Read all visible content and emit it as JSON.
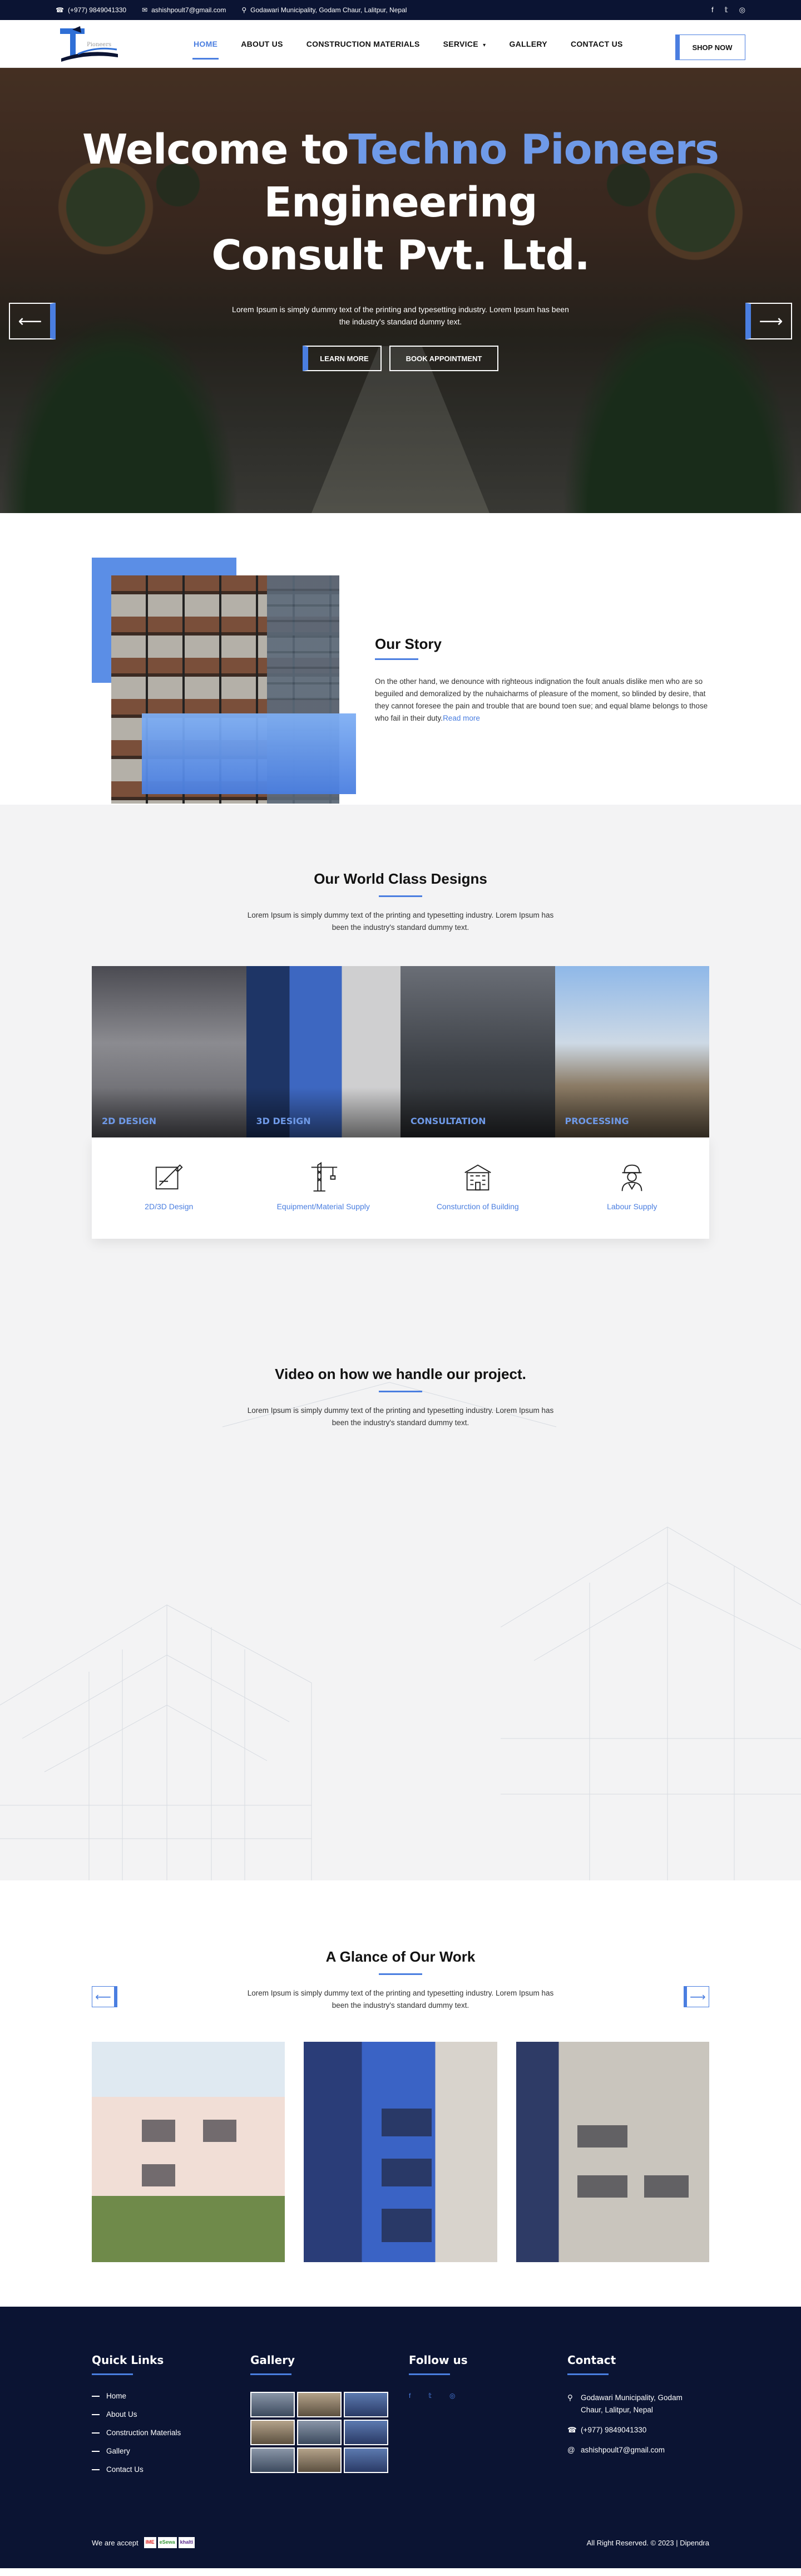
{
  "topbar": {
    "phone": "(+977) 9849041330",
    "email": "ashishpoult7@gmail.com",
    "address": "Godawari Municipality, Godam Chaur, Lalitpur, Nepal",
    "social_icons": [
      "facebook-icon",
      "twitter-icon",
      "instagram-icon"
    ]
  },
  "nav": {
    "items": [
      {
        "label": "HOME",
        "active": true
      },
      {
        "label": "ABOUT US"
      },
      {
        "label": "CONSTRUCTION MATERIALS"
      },
      {
        "label": "SERVICE"
      },
      {
        "label": "GALLERY"
      },
      {
        "label": "CONTACT US"
      }
    ],
    "shop_now": "SHOP NOW"
  },
  "hero": {
    "title_1": "Welcome to",
    "title_blue": "Techno Pioneers",
    "title_2": "Engineering Consult Pvt. Ltd.",
    "subtitle": "Lorem Ipsum is simply dummy text of the printing and typesetting industry. Lorem Ipsum has been the industry's standard dummy text.",
    "learn_more": "LEARN MORE",
    "book_appointment": "BOOK APPOINTMENT"
  },
  "story": {
    "title": "Our Story",
    "body": "On the other hand, we denounce with righteous indignation the foult anuals dislike men who are so beguiled and demoralized by the nuhaicharms of pleasure of the moment, so blinded by desire, that they cannot foresee the pain and trouble that are bound toen sue; and equal blame belongs to those who fail in their duty.",
    "read_more": "Read more"
  },
  "designs": {
    "title": "Our World Class Designs",
    "text": "Lorem Ipsum is simply dummy text of the printing and typesetting industry. Lorem Ipsum has been the industry's standard dummy text.",
    "tiles": [
      "2D DESIGN",
      "3D DESIGN",
      "CONSULTATION",
      "PROCESSING"
    ],
    "services": [
      {
        "label": "2D/3D Design",
        "icon": "drafting-icon"
      },
      {
        "label": "Equipment/Material Supply",
        "icon": "crane-icon"
      },
      {
        "label": "Consturction of Building",
        "icon": "building-icon"
      },
      {
        "label": "Labour Supply",
        "icon": "worker-icon"
      }
    ]
  },
  "video": {
    "title": "Video on how we handle our project.",
    "text": "Lorem Ipsum is simply dummy text of the printing and typesetting industry. Lorem Ipsum has been the industry's standard dummy text."
  },
  "work": {
    "title": "A Glance of Our Work",
    "text": "Lorem Ipsum is simply dummy text of the printing and typesetting industry. Lorem Ipsum has been the industry's standard dummy text."
  },
  "footer": {
    "quick_links_title": "Quick Links",
    "quick_links": [
      "Home",
      "About Us",
      "Construction Materials",
      "Gallery",
      "Contact Us"
    ],
    "gallery_title": "Gallery",
    "follow_title": "Follow us",
    "contact_title": "Contact",
    "contact_address": "Godawari Municipality, Godam Chaur, Lalitpur, Nepal",
    "contact_phone": "(+977) 9849041330",
    "contact_email": "ashishpoult7@gmail.com",
    "we_accept": "We are accept",
    "payment_logos": [
      "IME",
      "eSewa",
      "khalti"
    ],
    "copyright": "All Right Reserved. © 2023 | Dipendra"
  },
  "colors": {
    "accent": "#4a7ee0",
    "dark_navy": "#0b1433"
  }
}
